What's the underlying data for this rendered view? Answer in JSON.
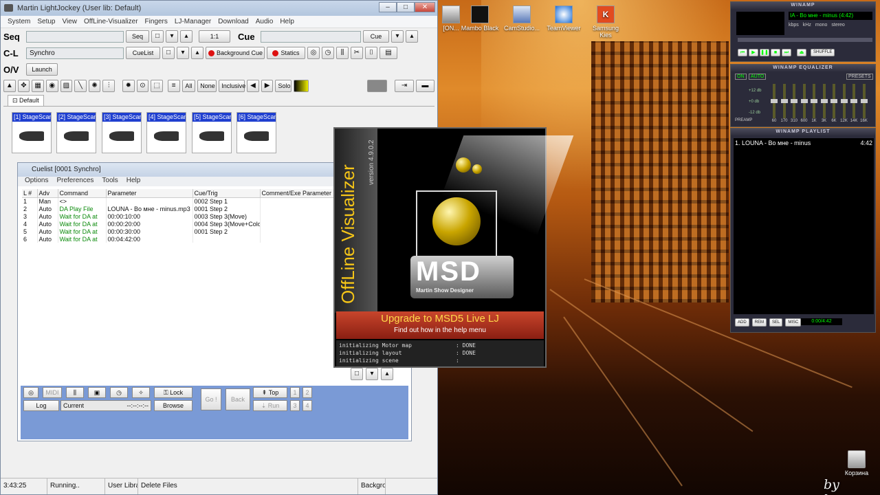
{
  "desktop": {
    "icons": [
      {
        "label": "[ON...",
        "name": "on-shortcut"
      },
      {
        "label": "Mambo Black",
        "name": "mambo-black"
      },
      {
        "label": "CamStudio...",
        "name": "camstudio"
      },
      {
        "label": "TeamViewer",
        "name": "teamviewer"
      },
      {
        "label": "Samsung Kies",
        "name": "samsung-kies"
      }
    ],
    "recycle_label": "Корзина",
    "watermark": "by kenny"
  },
  "lj": {
    "title": "Martin LightJockey (User lib: Default)",
    "menu": [
      "System",
      "Setup",
      "View",
      "OffLine-Visualizer",
      "Fingers",
      "LJ-Manager",
      "Download",
      "Audio",
      "Help"
    ],
    "seq_label": "Seq",
    "seq_button": "Seq",
    "seq_counter": "1:1",
    "cue_label": "Cue",
    "cue_button": "Cue",
    "cl_label": "C-L",
    "cl_value": "Synchro",
    "cuelist_button": "CueList",
    "background_cue_button": "Background Cue",
    "statics_button": "Statics",
    "ov_label": "O/V",
    "launch_button": "Launch",
    "toolbar2": {
      "all": "All",
      "none": "None",
      "inclusive": "Inclusive",
      "solo": "Solo"
    },
    "tab_default": "Default",
    "fixtures": [
      "[1] StageScan",
      "[2] StageScan",
      "[3] StageScan",
      "[4] StageScan",
      "[5] StageScan",
      "[6] StageScan"
    ]
  },
  "cuelist": {
    "title": "Cuelist [0001 Synchro]",
    "menu": [
      "Options",
      "Preferences",
      "Tools",
      "Help"
    ],
    "columns": [
      "L #",
      "Adv",
      "Command",
      "Parameter",
      "Cue/Trig",
      "Comment/Exe Parameter"
    ],
    "rows": [
      {
        "n": "1",
        "adv": "Man",
        "cmd": "<>",
        "param": "",
        "cue": "0002 Step 1",
        "comment": "",
        "green": false
      },
      {
        "n": "2",
        "adv": "Auto",
        "cmd": "DA Play File",
        "param": "LOUNA - Во мне - minus.mp3",
        "cue": "0001 Step 2",
        "comment": "",
        "green": true
      },
      {
        "n": "3",
        "adv": "Auto",
        "cmd": "Wait for DA at",
        "param": "00:00:10:00",
        "cue": "0003 Step 3(Move)",
        "comment": "",
        "green": true
      },
      {
        "n": "4",
        "adv": "Auto",
        "cmd": "Wait for DA at",
        "param": "00:00:20:00",
        "cue": "0004 Step 3(Move+Colo",
        "comment": "",
        "green": true
      },
      {
        "n": "5",
        "adv": "Auto",
        "cmd": "Wait for DA at",
        "param": "00:00:30:00",
        "cue": "0001 Step 2",
        "comment": "",
        "green": true
      },
      {
        "n": "6",
        "adv": "Auto",
        "cmd": "Wait for DA at",
        "param": "00:04:42:00",
        "cue": "",
        "comment": "",
        "green": true
      }
    ],
    "bottom": {
      "midi": "MIDI",
      "lock": "Lock",
      "go": "Go !",
      "back": "Back",
      "top": "Top",
      "run": "Run",
      "log": "Log",
      "current": "Current",
      "time": "--:--:--:--",
      "browse": "Browse",
      "n1": "1",
      "n2": "2",
      "n3": "3",
      "n4": "4"
    }
  },
  "status": {
    "time": "3:43:25",
    "running": "Running..",
    "userlib": "User Libra",
    "delete": "Delete Files",
    "backgr": "Backgro"
  },
  "splash": {
    "title": "OffLine Visualizer",
    "version": "version 4.9.0.2",
    "logo": "MSD",
    "logo_sub": "Martin Show Designer",
    "upgrade": "Upgrade to MSD5 Live LJ",
    "find": "Find out how in the help menu",
    "log": [
      {
        "k": "initializing Motor map",
        "v": ": DONE"
      },
      {
        "k": "initializing layout",
        "v": ": DONE"
      },
      {
        "k": "initializing scene",
        "v": ":"
      }
    ]
  },
  "winamp": {
    "title": "WINAMP",
    "track": "IA - Во мне - minus (4:42)",
    "kbps": "kbps",
    "khz": "kHz",
    "mono": "mono",
    "stereo": "stereo",
    "eq_title": "WINAMP EQUALIZER",
    "on": "ON",
    "auto": "AUTO",
    "presets": "PRESETS",
    "preamp": "PREAMP",
    "db": [
      "+12 db",
      "+0 db",
      "-12 db"
    ],
    "bands": [
      "60",
      "170",
      "310",
      "600",
      "1K",
      "3K",
      "6K",
      "12K",
      "14K",
      "16K"
    ],
    "eq_levels": [
      0.5,
      0.5,
      0.5,
      0.5,
      0.5,
      0.5,
      0.5,
      0.5,
      0.5,
      0.5
    ],
    "pl_title": "WINAMP PLAYLIST",
    "pl_item": "1. LOUNA - Во мне - minus",
    "pl_time": "4:42",
    "pl_buttons": [
      "ADD",
      "REM",
      "SEL",
      "MISC"
    ],
    "pl_counter": "0:00/4:42",
    "shuffle": "SHUFFLE"
  }
}
